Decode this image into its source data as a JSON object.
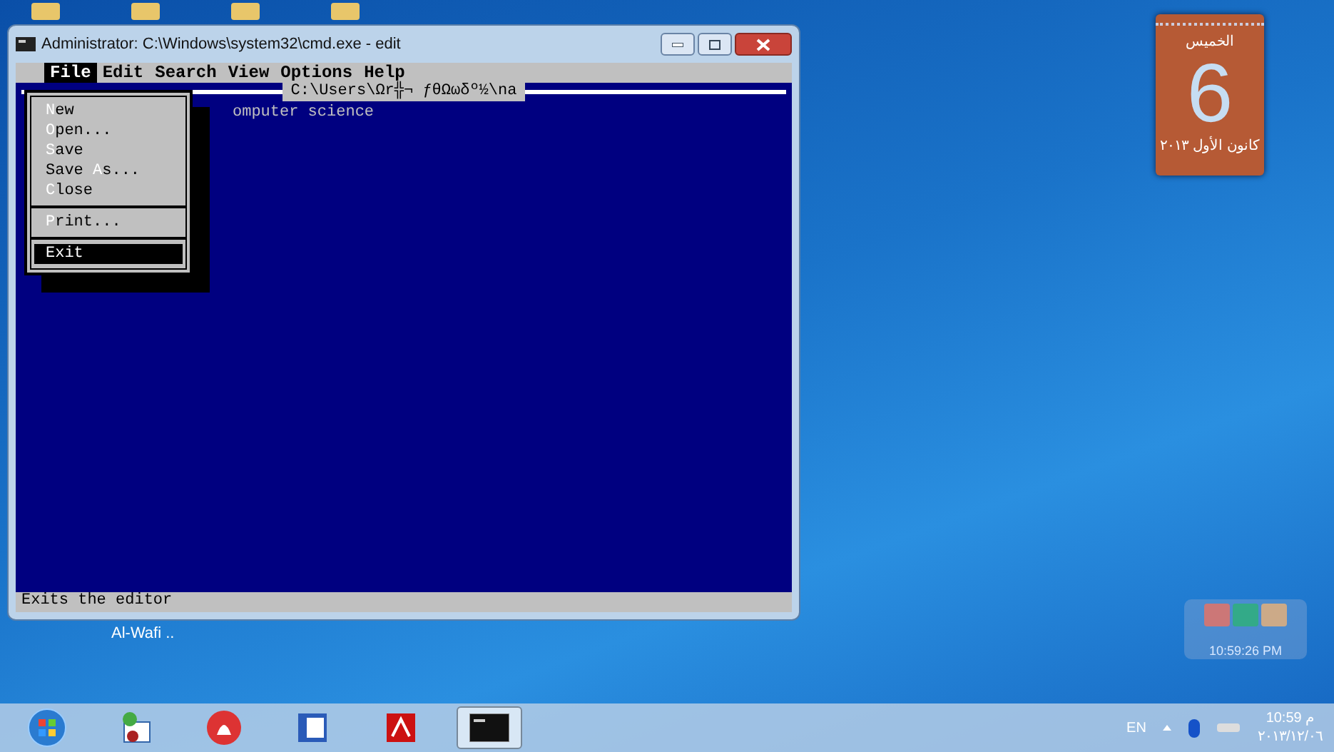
{
  "window": {
    "title": "Administrator: C:\\Windows\\system32\\cmd.exe - edit"
  },
  "editor": {
    "menu_bar": [
      {
        "label": "File",
        "selected": true
      },
      {
        "label": "Edit",
        "selected": false
      },
      {
        "label": "Search",
        "selected": false
      },
      {
        "label": "View",
        "selected": false
      },
      {
        "label": "Options",
        "selected": false
      },
      {
        "label": "Help",
        "selected": false
      }
    ],
    "file_path": "C:\\Users\\Ωr╬¬ ƒθΩωδº½\\na",
    "text": "omputer science",
    "file_menu": [
      [
        {
          "hotkey": "N",
          "after": "ew",
          "selected": false
        },
        {
          "hotkey": "O",
          "after": "pen...",
          "selected": false
        },
        {
          "hotkey": "S",
          "after": "ave",
          "selected": false
        },
        {
          "hotkey": "A",
          "before": "Save ",
          "after": "s...",
          "selected": false
        },
        {
          "hotkey": "C",
          "after": "lose",
          "selected": false
        }
      ],
      [
        {
          "hotkey": "P",
          "after": "rint...",
          "selected": false
        }
      ],
      [
        {
          "before": "Exit",
          "selected": true
        }
      ]
    ],
    "status_bar": "Exits the editor"
  },
  "desktop_label": "Al-Wafi ..",
  "calendar_gadget": {
    "weekday": "الخميس",
    "day": "6",
    "month_year": "كانون الأول ٢٠١٣"
  },
  "clock_gadget": {
    "time": "10:59:26 PM"
  },
  "taskbar": {
    "apps": [
      {
        "kind": "start",
        "selected": false
      },
      {
        "kind": "dictionary",
        "selected": false
      },
      {
        "kind": "burner",
        "selected": false
      },
      {
        "kind": "word",
        "selected": false
      },
      {
        "kind": "pdf",
        "selected": false
      },
      {
        "kind": "console",
        "selected": true
      }
    ],
    "language": "EN",
    "time": "10:59 م",
    "date": "٢٠١٣/١٢/٠٦"
  }
}
